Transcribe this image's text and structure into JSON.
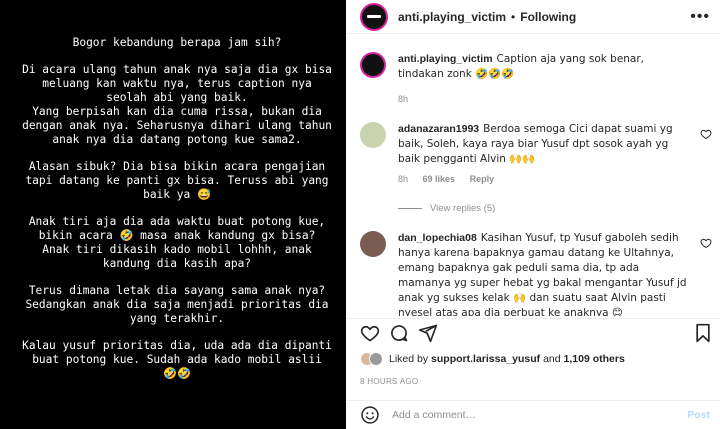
{
  "story": {
    "paragraphs": [
      "Bogor kebandung berapa jam sih?",
      "Di acara ulang tahun anak nya saja dia gx bisa meluang kan waktu nya, terus caption nya seolah abi yang baik.\nYang berpisah kan dia cuma rissa, bukan dia dengan anak nya. Seharusnya dihari ulang tahun anak nya dia datang potong kue sama2.",
      "Alasan sibuk? Dia bisa bikin acara pengajian tapi datang ke panti gx bisa. Teruss abi yang baik ya 😅",
      "Anak tiri aja dia ada waktu buat potong kue, bikin acara 🤣 masa anak kandung gx bisa? Anak tiri dikasih kado mobil lohhh, anak kandung dia kasih apa?",
      "Terus dimana letak dia sayang sama anak nya? Sedangkan anak dia saja menjadi prioritas dia yang terakhir.",
      "Kalau yusuf prioritas dia, uda ada dia dipanti buat potong kue. Sudah ada kado mobil aslii 🤣🤣"
    ]
  },
  "header": {
    "username": "anti.playing_victim",
    "separator": "•",
    "follow_label": "Following",
    "more_icon": "more-horizontal-icon"
  },
  "caption": {
    "username": "anti.playing_victim",
    "text": "Caption aja yang sok benar, tindakan zonk 🤣🤣🤣",
    "time": "8h"
  },
  "comments": [
    {
      "username": "adanazaran1993",
      "text": "Berdoa semoga Cici dapat suami yg baik, Soleh, kaya raya biar Yusuf dpt sosok ayah yg baik pengganti Alvin 🙌🙌",
      "time": "8h",
      "likes": "69 likes",
      "reply": "Reply",
      "avatar_color": "#c9d3b0"
    },
    {
      "username": "dan_lopechia08",
      "text": "Kasihan Yusuf, tp Yusuf gaboleh sedih hanya karena bapaknya gamau datang ke Ultahnya, emang bapaknya gak peduli sama dia, tp ada mamanya yg super hebat yg bakal mengantar Yusuf jd anak yg sukses kelak 🙌 dan suatu saat Alvin pasti nyesel atas apa dia perbuat ke anaknya 😊",
      "avatar_color": "#7a5c52"
    }
  ],
  "view_replies": "View replies (5)",
  "actions": [
    "heart-icon",
    "comment-icon",
    "share-icon",
    "bookmark-icon"
  ],
  "likes": {
    "prefix": "Liked by ",
    "user": "support.larissa_yusuf",
    "middle": " and ",
    "count": "1,109 others"
  },
  "date": "8 HOURS AGO",
  "add_comment": {
    "placeholder": "Add a comment…",
    "post_label": "Post"
  },
  "colors": {
    "accent": "#0095f6",
    "post_disabled": "#b2dffc",
    "muted": "#8e8e8e",
    "story_bg": "#000000"
  }
}
